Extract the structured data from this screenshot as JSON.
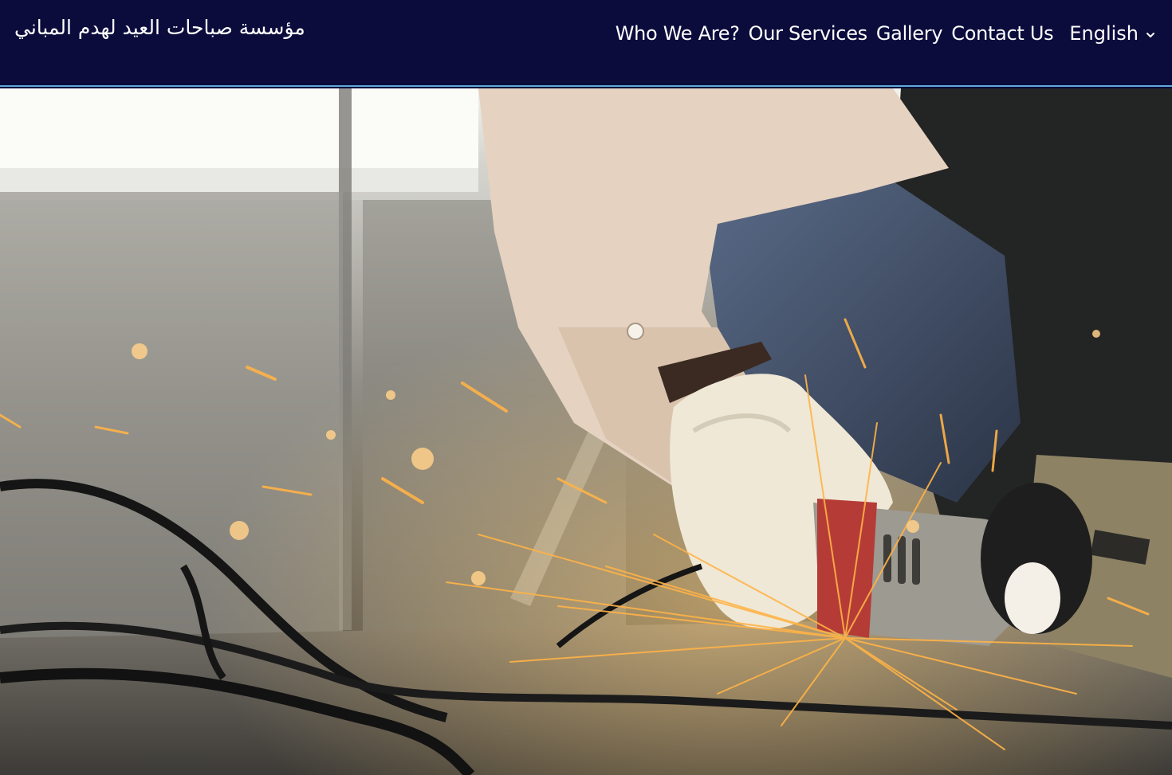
{
  "header": {
    "brand": "مؤسسة صباحات العيد لهدم المباني",
    "nav": [
      {
        "label": "Who We Are?"
      },
      {
        "label": "Our Services"
      },
      {
        "label": "Gallery"
      },
      {
        "label": "Contact Us"
      }
    ],
    "language": {
      "selected": "English",
      "icon": "chevron-down-icon"
    }
  },
  "hero": {
    "icon": "hero-photo-worker-angle-grinder-sparks"
  },
  "colors": {
    "header_bg": "#0b0c3c",
    "header_border": "#5fa9d8",
    "text": "#ffffff"
  }
}
